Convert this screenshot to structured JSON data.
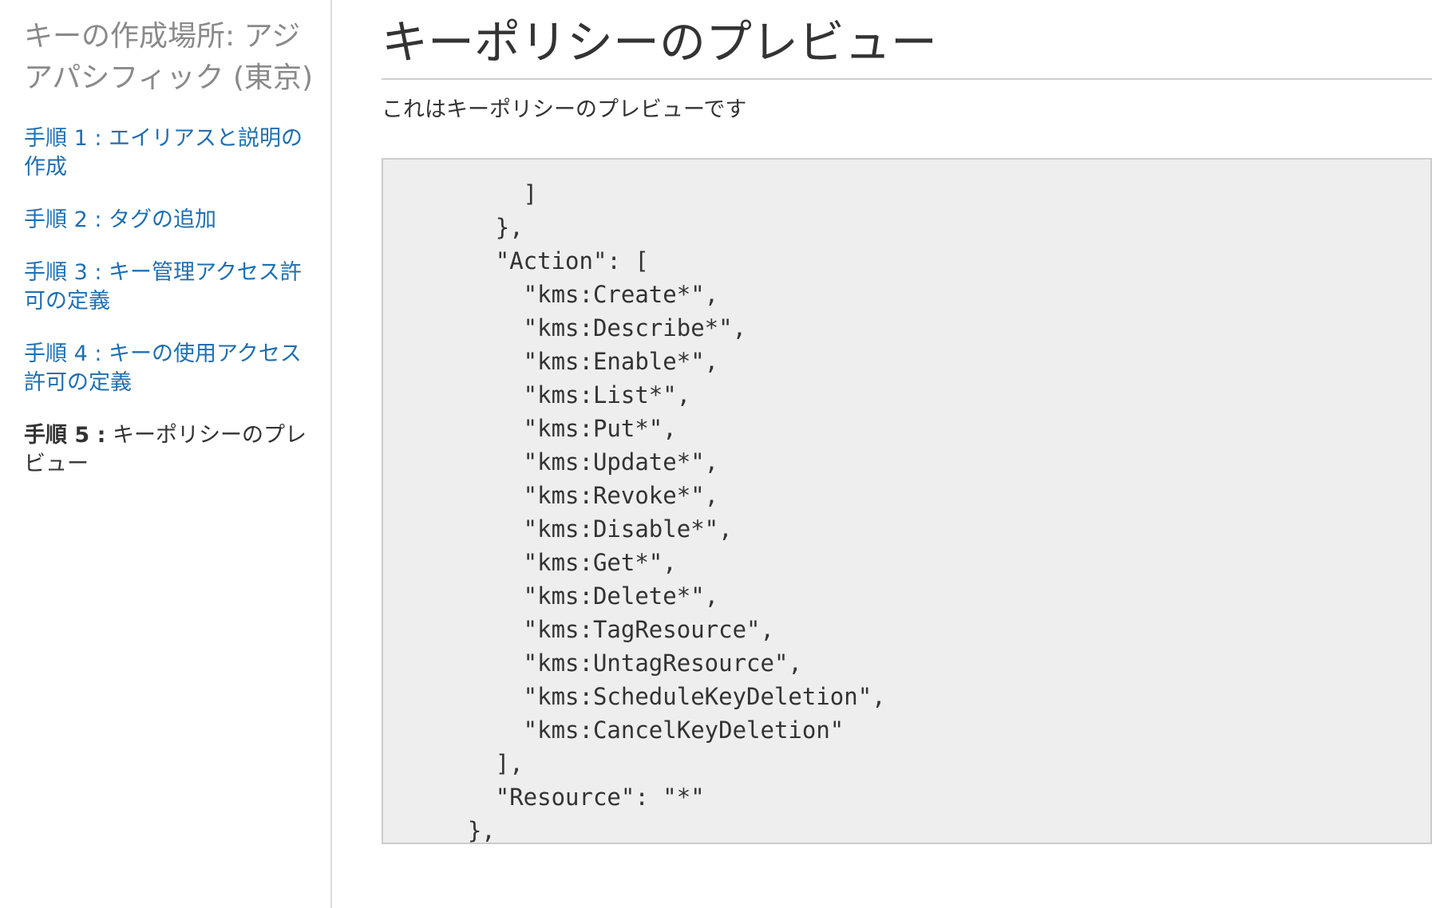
{
  "sidebar": {
    "region_title": "キーの作成場所: アジアパシフィック (東京)",
    "steps": [
      {
        "num": "手順 1 :",
        "label": "エイリアスと説明の作成"
      },
      {
        "num": "手順 2 :",
        "label": "タグの追加"
      },
      {
        "num": "手順 3 :",
        "label": "キー管理アクセス許可の定義"
      },
      {
        "num": "手順 4 :",
        "label": "キーの使用アクセス許可の定義"
      },
      {
        "num": "手順 5 :",
        "label": "キーポリシーのプレビュー"
      }
    ],
    "current_step_index": 4
  },
  "main": {
    "title": "キーポリシーのプレビュー",
    "description": "これはキーポリシーのプレビューです",
    "policy_text": "\n        ]\n      },\n      \"Action\": [\n        \"kms:Create*\",\n        \"kms:Describe*\",\n        \"kms:Enable*\",\n        \"kms:List*\",\n        \"kms:Put*\",\n        \"kms:Update*\",\n        \"kms:Revoke*\",\n        \"kms:Disable*\",\n        \"kms:Get*\",\n        \"kms:Delete*\",\n        \"kms:TagResource\",\n        \"kms:UntagResource\",\n        \"kms:ScheduleKeyDeletion\",\n        \"kms:CancelKeyDeletion\"\n      ],\n      \"Resource\": \"*\"\n    },\n    {"
  }
}
